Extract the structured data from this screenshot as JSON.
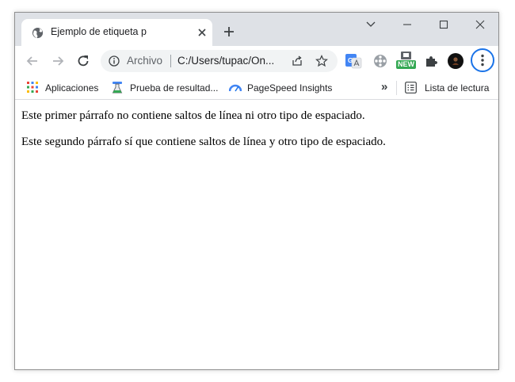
{
  "tab": {
    "title": "Ejemplo de etiqueta p",
    "favicon": "globe-icon"
  },
  "window_controls": [
    "chevron-down-icon",
    "minimize-icon",
    "maximize-icon",
    "close-icon"
  ],
  "toolbar": {
    "scheme_label": "Archivo",
    "url": "C:/Users/tupac/On...",
    "extensions": [
      "translate-extension-icon",
      "film-reel-extension-icon",
      "new-badge-extension-icon",
      "puzzle-icon",
      "profile-avatar"
    ],
    "new_badge": "NEW"
  },
  "bookmarks": {
    "items": [
      {
        "label": "Aplicaciones",
        "icon": "apps-grid-icon"
      },
      {
        "label": "Prueba de resultad...",
        "icon": "flask-icon"
      },
      {
        "label": "PageSpeed Insights",
        "icon": "pagespeed-icon"
      }
    ],
    "overflow": "»",
    "reading_list": "Lista de lectura"
  },
  "content": {
    "paragraphs": [
      "Este primer párrafo no contiene saltos de línea ni otro tipo de espaciado.",
      "Este segundo párrafo sí que contiene saltos de línea y otro tipo de espaciado."
    ]
  },
  "colors": {
    "tabstrip": "#dee1e6",
    "omnibox": "#f1f3f4",
    "accent": "#1a73e8"
  }
}
